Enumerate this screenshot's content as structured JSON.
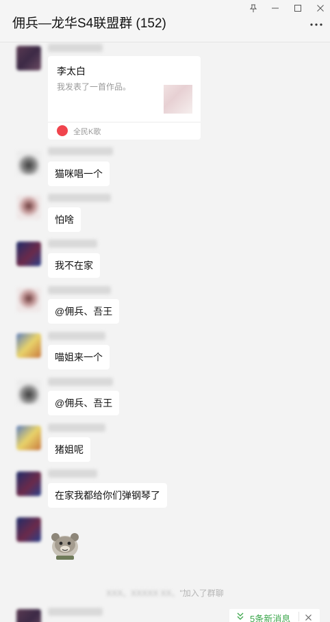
{
  "window": {
    "title": "佣兵—龙华S4联盟群 (152)",
    "controls": [
      "pin-icon",
      "minimize-icon",
      "maximize-icon",
      "close-icon"
    ],
    "more_icon": "more-icon"
  },
  "messages": [
    {
      "type": "card",
      "avatar": "dark",
      "card": {
        "title": "李太白",
        "desc": "我发表了一首作品。",
        "source": "全民K歌"
      }
    },
    {
      "type": "text",
      "avatar": "tree",
      "text": "猫咪唱一个"
    },
    {
      "type": "text",
      "avatar": "girl",
      "text": "怕啥"
    },
    {
      "type": "text",
      "avatar": "navy",
      "text": "我不在家"
    },
    {
      "type": "text",
      "avatar": "girl",
      "text": "@佣兵、吾王"
    },
    {
      "type": "text",
      "avatar": "cartoon",
      "text": "喵姐来一个"
    },
    {
      "type": "text",
      "avatar": "tree",
      "text": "@佣兵、吾王"
    },
    {
      "type": "text",
      "avatar": "cartoon",
      "text": "猪姐呢"
    },
    {
      "type": "text",
      "avatar": "navy",
      "text": "在家我都给你们弹钢琴了"
    },
    {
      "type": "sticker",
      "avatar": "navy",
      "sticker": "bear-sticker"
    }
  ],
  "system_message": {
    "suffix": "\"加入了群聊"
  },
  "new_messages": {
    "label": "5条新消息",
    "icon": "double-chevron-down-icon",
    "close_icon": "close-icon"
  },
  "colors": {
    "accent_green": "#3aa64a",
    "background": "#f3f3f3",
    "bubble": "#ffffff",
    "card_source_red": "#f0444d"
  }
}
